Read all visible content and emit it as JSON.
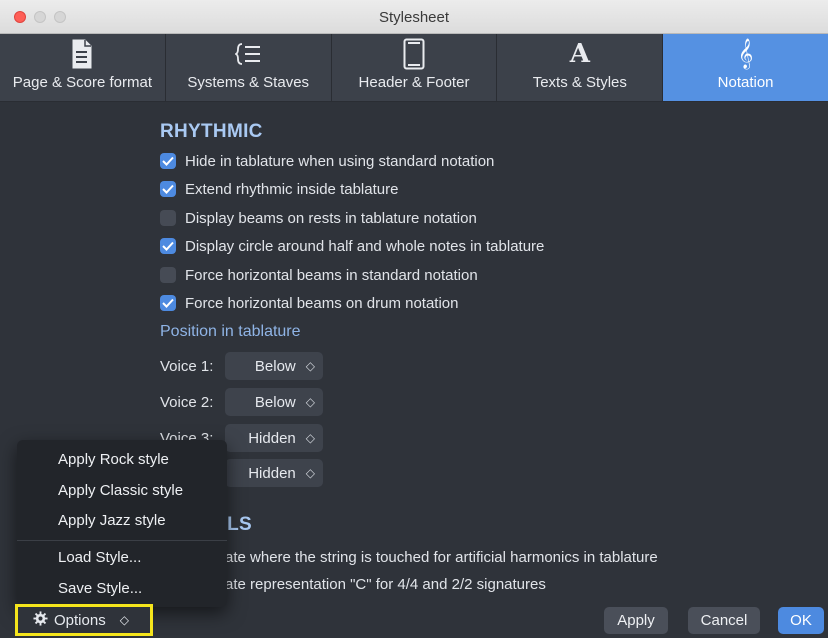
{
  "window": {
    "title": "Stylesheet"
  },
  "tabs": [
    {
      "label": "Page & Score format",
      "icon": "page-icon"
    },
    {
      "label": "Systems & Staves",
      "icon": "list-icon"
    },
    {
      "label": "Header & Footer",
      "icon": "tablet-icon"
    },
    {
      "label": "Texts & Styles",
      "icon": "letter-a-icon"
    },
    {
      "label": "Notation",
      "icon": "treble-clef-icon",
      "active": true
    }
  ],
  "rhythmic": {
    "title": "RHYTHMIC",
    "options": [
      {
        "label": "Hide in tablature when using standard notation",
        "checked": true
      },
      {
        "label": "Extend rhythmic inside tablature",
        "checked": true
      },
      {
        "label": "Display beams on rests in tablature notation",
        "checked": false
      },
      {
        "label": "Display circle around half and whole notes in tablature",
        "checked": true
      },
      {
        "label": "Force horizontal beams in standard notation",
        "checked": false
      },
      {
        "label": "Force horizontal beams on drum notation",
        "checked": true
      }
    ],
    "position_heading": "Position in tablature",
    "voices": [
      {
        "label": "Voice 1:",
        "value": "Below"
      },
      {
        "label": "Voice 2:",
        "value": "Below"
      },
      {
        "label": "Voice 3:",
        "value": "Hidden"
      },
      {
        "label": "",
        "value": "Hidden"
      }
    ]
  },
  "symbols": {
    "title_partial": "OLS",
    "options": [
      "ate where the string is touched for artificial harmonics in tablature",
      "ate representation \"C\" for 4/4 and 2/2 signatures"
    ]
  },
  "options_menu": {
    "items": [
      "Apply Rock style",
      "Apply Classic style",
      "Apply Jazz style"
    ],
    "items2": [
      "Load Style...",
      "Save Style..."
    ]
  },
  "footer": {
    "options_label": "Options",
    "apply_label": "Apply",
    "cancel_label": "Cancel",
    "ok_label": "OK"
  },
  "colors": {
    "accent": "#5591e2",
    "highlight": "#f5e51c",
    "heading": "#a9c9f2"
  }
}
